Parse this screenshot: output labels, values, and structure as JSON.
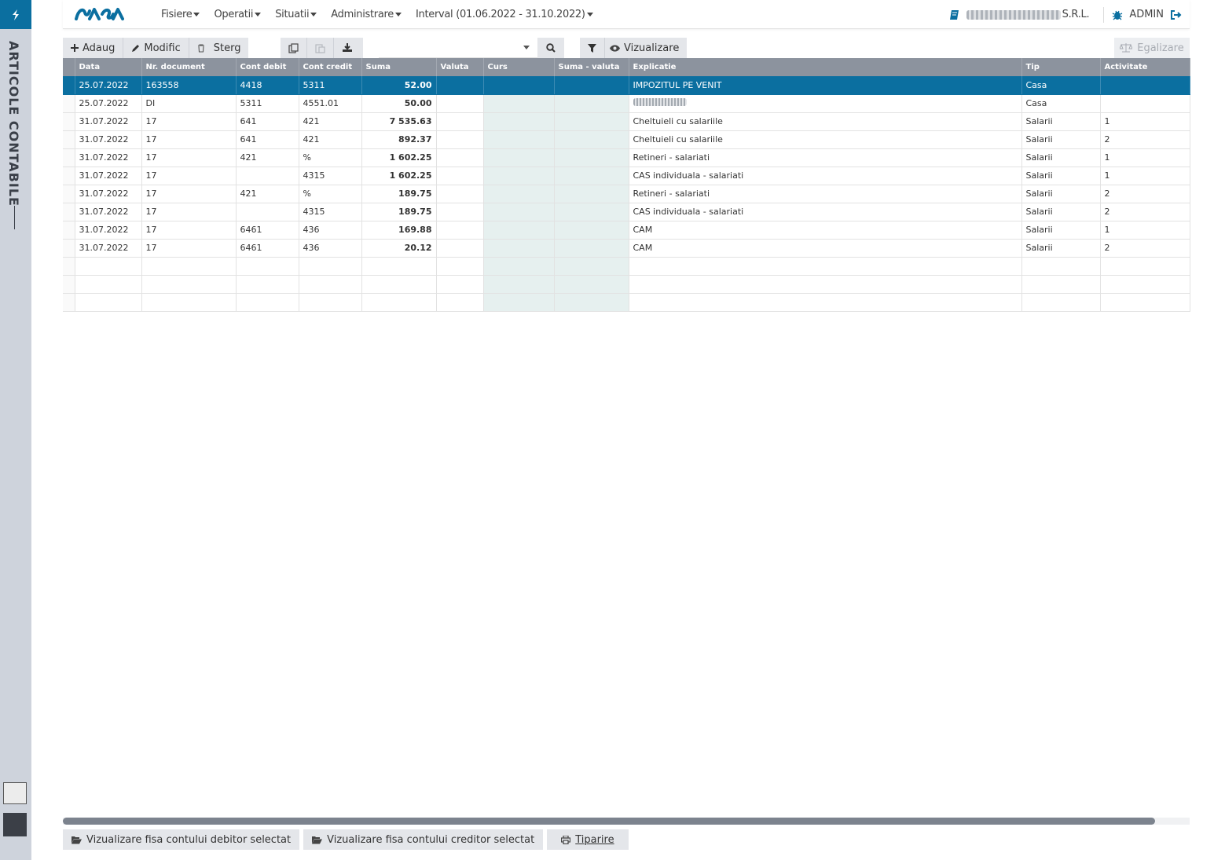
{
  "sidebar": {
    "title": "ARTICOLE CONTABILE"
  },
  "header": {
    "menu": [
      {
        "label": "Fisiere"
      },
      {
        "label": "Operatii"
      },
      {
        "label": "Situatii"
      },
      {
        "label": "Administrare"
      },
      {
        "label": "Interval (01.06.2022 - 31.10.2022)"
      }
    ],
    "company_suffix": "S.R.L.",
    "user": "ADMIN"
  },
  "toolbar": {
    "add_label": "Adaug",
    "edit_label": "Modific",
    "delete_label": "Sterg",
    "view_label": "Vizualizare",
    "equalize_label": "Egalizare",
    "combo_value": ""
  },
  "table": {
    "columns": [
      "Data",
      "Nr. document",
      "Cont debit",
      "Cont credit",
      "Suma",
      "Valuta",
      "Curs",
      "Suma - valuta",
      "Explicatie",
      "Tip",
      "Activitate"
    ],
    "rows": [
      {
        "data": "25.07.2022",
        "doc": "163558",
        "debit": "4418",
        "credit": "5311",
        "suma": "52.00",
        "valuta": "",
        "curs": "",
        "suma_valuta": "",
        "explicatie": "IMPOZITUL PE VENIT",
        "tip": "Casa",
        "activitate": ""
      },
      {
        "data": "25.07.2022",
        "doc": "DI",
        "debit": "5311",
        "credit": "4551.01",
        "suma": "50.00",
        "valuta": "",
        "curs": "",
        "suma_valuta": "",
        "explicatie": "",
        "tip": "Casa",
        "activitate": ""
      },
      {
        "data": "31.07.2022",
        "doc": "17",
        "debit": "641",
        "credit": "421",
        "suma": "7 535.63",
        "valuta": "",
        "curs": "",
        "suma_valuta": "",
        "explicatie": "Cheltuieli cu salariile",
        "tip": "Salarii",
        "activitate": "1"
      },
      {
        "data": "31.07.2022",
        "doc": "17",
        "debit": "641",
        "credit": "421",
        "suma": "892.37",
        "valuta": "",
        "curs": "",
        "suma_valuta": "",
        "explicatie": "Cheltuieli cu salariile",
        "tip": "Salarii",
        "activitate": "2"
      },
      {
        "data": "31.07.2022",
        "doc": "17",
        "debit": "421",
        "credit": "%",
        "suma": "1 602.25",
        "valuta": "",
        "curs": "",
        "suma_valuta": "",
        "explicatie": "Retineri - salariati",
        "tip": "Salarii",
        "activitate": "1"
      },
      {
        "data": "31.07.2022",
        "doc": "17",
        "debit": "",
        "credit": "4315",
        "suma": "1 602.25",
        "valuta": "",
        "curs": "",
        "suma_valuta": "",
        "explicatie": "CAS individuala - salariati",
        "tip": "Salarii",
        "activitate": "1"
      },
      {
        "data": "31.07.2022",
        "doc": "17",
        "debit": "421",
        "credit": "%",
        "suma": "189.75",
        "valuta": "",
        "curs": "",
        "suma_valuta": "",
        "explicatie": "Retineri - salariati",
        "tip": "Salarii",
        "activitate": "2"
      },
      {
        "data": "31.07.2022",
        "doc": "17",
        "debit": "",
        "credit": "4315",
        "suma": "189.75",
        "valuta": "",
        "curs": "",
        "suma_valuta": "",
        "explicatie": "CAS individuala - salariati",
        "tip": "Salarii",
        "activitate": "2"
      },
      {
        "data": "31.07.2022",
        "doc": "17",
        "debit": "6461",
        "credit": "436",
        "suma": "169.88",
        "valuta": "",
        "curs": "",
        "suma_valuta": "",
        "explicatie": "CAM",
        "tip": "Salarii",
        "activitate": "1"
      },
      {
        "data": "31.07.2022",
        "doc": "17",
        "debit": "6461",
        "credit": "436",
        "suma": "20.12",
        "valuta": "",
        "curs": "",
        "suma_valuta": "",
        "explicatie": "CAM",
        "tip": "Salarii",
        "activitate": "2"
      }
    ]
  },
  "bottom": {
    "debit_btn": "Vizualizare fisa contului debitor selectat",
    "credit_btn": "Vizualizare fisa contului creditor selectat",
    "print_btn": "Tiparire"
  },
  "colors": {
    "accent": "#0b6fa0",
    "header_bg": "#8c939e",
    "sidebar_bg": "#ced3dc"
  }
}
